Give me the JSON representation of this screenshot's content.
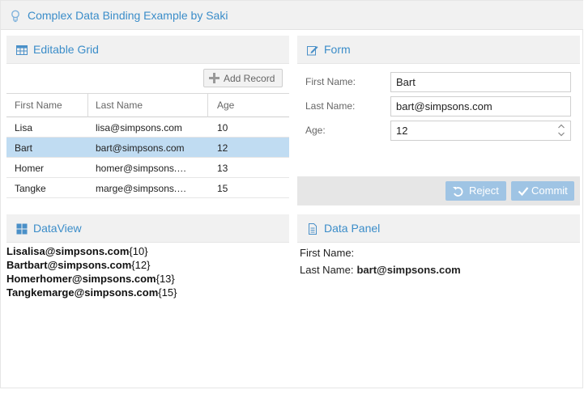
{
  "app": {
    "title": "Complex Data Binding Example by Saki",
    "icon": "lightbulb-icon",
    "accent": "#3b8dc9"
  },
  "grid": {
    "title": "Editable Grid",
    "icon": "grid-icon",
    "add_record_label": "Add Record",
    "columns": [
      "First Name",
      "Last Name",
      "Age"
    ],
    "selected_row": 1,
    "selection_color": "#c0dcf2",
    "rows": [
      {
        "first": "Lisa",
        "last": "lisa@simpsons.com",
        "age": "10"
      },
      {
        "first": "Bart",
        "last": "bart@simpsons.com",
        "age": "12"
      },
      {
        "first": "Homer",
        "last": "homer@simpsons.…",
        "age": "13"
      },
      {
        "first": "Tangke",
        "last": "marge@simpsons.…",
        "age": "15"
      }
    ]
  },
  "form": {
    "title": "Form",
    "icon": "edit-icon",
    "first_name_label": "First Name:",
    "first_name_value": "Bart",
    "last_name_label": "Last Name:",
    "last_name_value": "bart@simpsons.com",
    "age_label": "Age:",
    "age_value": "12",
    "reject_label": "Reject",
    "commit_label": "Commit"
  },
  "dataview": {
    "title": "DataView",
    "icon": "tiles-icon",
    "items": [
      {
        "name": "Lisalisa@simpsons.com",
        "age": "{10}"
      },
      {
        "name": "Bartbart@simpsons.com",
        "age": "{12}"
      },
      {
        "name": "Homerhomer@simpsons.com",
        "age": "{13}"
      },
      {
        "name": "Tangkemarge@simpsons.com",
        "age": "{15}"
      }
    ]
  },
  "datapanel": {
    "title": "Data Panel",
    "icon": "document-icon",
    "first_name_label": "First Name:",
    "first_name_value": "",
    "last_name_label": "Last Name:",
    "last_name_value": "bart@simpsons.com"
  }
}
